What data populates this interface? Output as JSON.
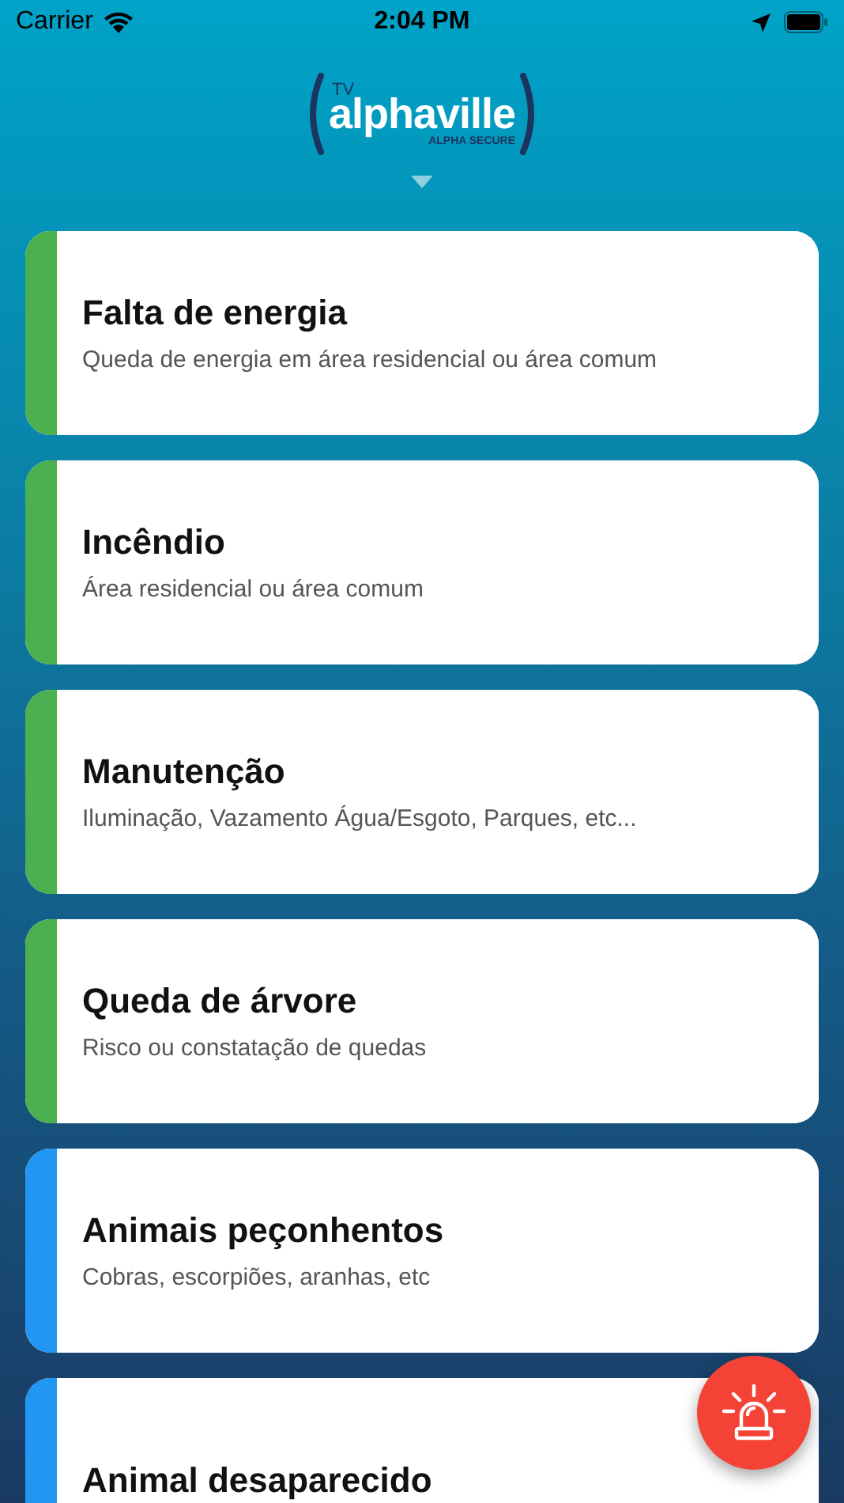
{
  "status_bar": {
    "carrier": "Carrier",
    "time": "2:04 PM"
  },
  "logo": {
    "prefix": "TV",
    "name": "alphaville",
    "tagline": "ALPHA SECURE"
  },
  "categories": [
    {
      "title": "Falta de energia",
      "subtitle": "Queda de energia em área residencial ou área comum",
      "color": "#4caf50"
    },
    {
      "title": "Incêndio",
      "subtitle": "Área residencial ou área comum",
      "color": "#4caf50"
    },
    {
      "title": "Manutenção",
      "subtitle": "Iluminação, Vazamento Água/Esgoto, Parques, etc...",
      "color": "#4caf50"
    },
    {
      "title": "Queda de árvore",
      "subtitle": "Risco ou constatação de quedas",
      "color": "#4caf50"
    },
    {
      "title": "Animais peçonhentos",
      "subtitle": "Cobras, escorpiões, aranhas, etc",
      "color": "#2196f3"
    },
    {
      "title": "Animal desaparecido",
      "color": "#2196f3"
    }
  ]
}
